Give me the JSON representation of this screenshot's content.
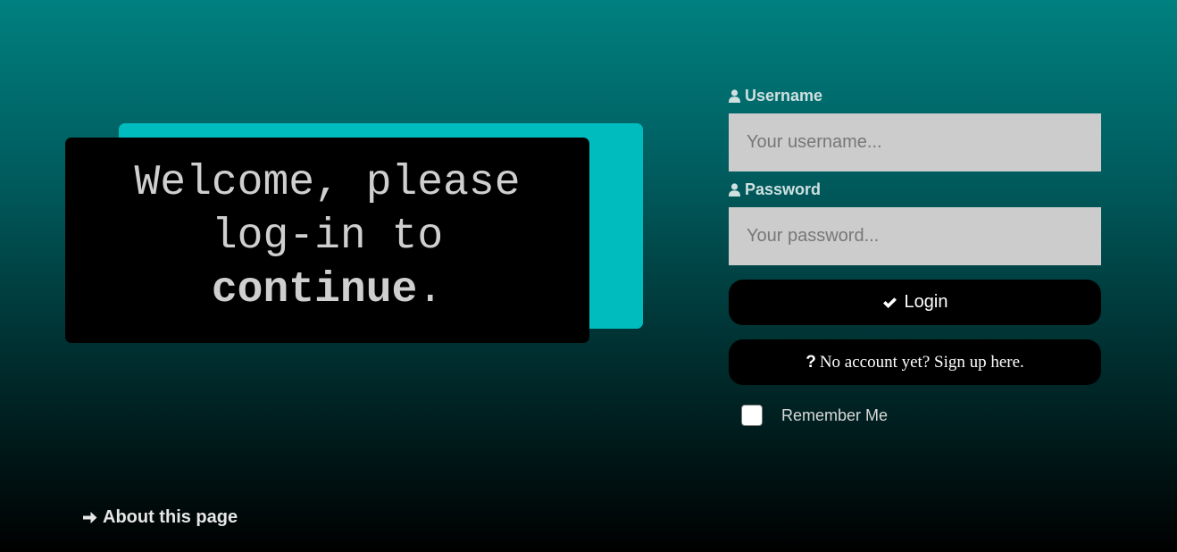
{
  "welcome": {
    "line1": "Welcome, please",
    "line2": "log-in to",
    "line3": "continue",
    "punct": "."
  },
  "form": {
    "username_label": "Username",
    "username_placeholder": "Your username...",
    "password_label": "Password",
    "password_placeholder": "Your password...",
    "login_label": "Login",
    "signup_icon": "?",
    "signup_label": "No account yet? Sign up here.",
    "remember_label": "Remember Me"
  },
  "footer": {
    "about_label": "About this page"
  },
  "icons": {
    "username": "user-icon",
    "password": "user-icon",
    "login": "check-icon",
    "signup": "question-icon",
    "about": "arrow-right-icon"
  },
  "colors": {
    "accent": "#00bcbf",
    "background_top": "#008080",
    "background_bottom": "#000000"
  }
}
